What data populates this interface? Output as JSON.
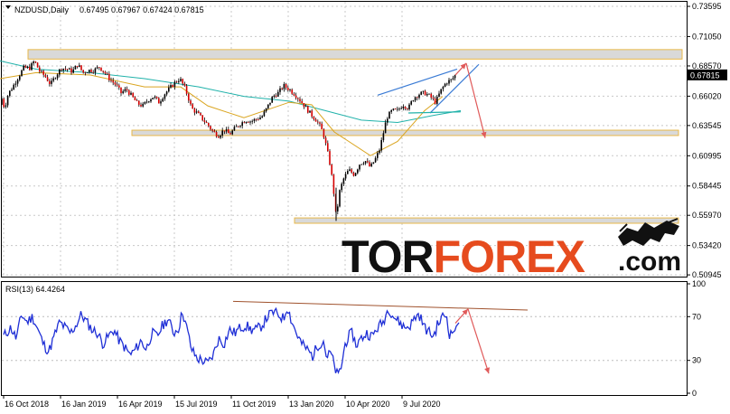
{
  "chart_data": [
    {
      "type": "candlestick",
      "symbol_header": "NZDUSD,Daily",
      "ohlc_header": "0.67495 0.67967 0.67424 0.67815",
      "current_price_label": "0.67815",
      "ylim": [
        0.508,
        0.7398
      ],
      "y_ticks": [
        "0.73595",
        "0.71050",
        "0.68570",
        "0.66020",
        "0.63545",
        "0.60995",
        "0.58445",
        "0.55970",
        "0.53420",
        "0.50945"
      ],
      "x_tick_labels": [
        "16 Oct 2018",
        "16 Jan 2019",
        "16 Apr 2019",
        "15 Jul 2019",
        "11 Oct 2019",
        "13 Jan 2020",
        "10 Apr 2020",
        "9 Jul 2020"
      ],
      "price_path": [
        [
          0,
          0.653
        ],
        [
          2,
          0.658
        ],
        [
          5,
          0.65
        ],
        [
          9,
          0.662
        ],
        [
          14,
          0.668
        ],
        [
          20,
          0.676
        ],
        [
          26,
          0.684
        ],
        [
          33,
          0.684
        ],
        [
          38,
          0.69
        ],
        [
          44,
          0.681
        ],
        [
          50,
          0.677
        ],
        [
          56,
          0.67
        ],
        [
          62,
          0.678
        ],
        [
          68,
          0.684
        ],
        [
          74,
          0.683
        ],
        [
          80,
          0.681
        ],
        [
          86,
          0.687
        ],
        [
          92,
          0.68
        ],
        [
          98,
          0.682
        ],
        [
          104,
          0.682
        ],
        [
          110,
          0.685
        ],
        [
          116,
          0.68
        ],
        [
          122,
          0.674
        ],
        [
          128,
          0.67
        ],
        [
          134,
          0.663
        ],
        [
          140,
          0.666
        ],
        [
          146,
          0.66
        ],
        [
          152,
          0.654
        ],
        [
          158,
          0.652
        ],
        [
          164,
          0.657
        ],
        [
          170,
          0.66
        ],
        [
          176,
          0.655
        ],
        [
          182,
          0.662
        ],
        [
          188,
          0.667
        ],
        [
          194,
          0.672
        ],
        [
          199,
          0.675
        ],
        [
          204,
          0.668
        ],
        [
          208,
          0.66
        ],
        [
          212,
          0.65
        ],
        [
          218,
          0.646
        ],
        [
          224,
          0.641
        ],
        [
          230,
          0.636
        ],
        [
          236,
          0.63
        ],
        [
          242,
          0.627
        ],
        [
          248,
          0.632
        ],
        [
          254,
          0.628
        ],
        [
          260,
          0.633
        ],
        [
          266,
          0.637
        ],
        [
          272,
          0.64
        ],
        [
          278,
          0.639
        ],
        [
          284,
          0.641
        ],
        [
          290,
          0.643
        ],
        [
          296,
          0.651
        ],
        [
          302,
          0.66
        ],
        [
          308,
          0.663
        ],
        [
          314,
          0.669
        ],
        [
          320,
          0.666
        ],
        [
          326,
          0.662
        ],
        [
          332,
          0.657
        ],
        [
          338,
          0.651
        ],
        [
          344,
          0.645
        ],
        [
          350,
          0.64
        ],
        [
          355,
          0.634
        ],
        [
          358,
          0.628
        ],
        [
          362,
          0.615
        ],
        [
          366,
          0.6
        ],
        [
          369,
          0.582
        ],
        [
          372,
          0.558
        ],
        [
          376,
          0.58
        ],
        [
          380,
          0.59
        ],
        [
          386,
          0.598
        ],
        [
          392,
          0.594
        ],
        [
          398,
          0.603
        ],
        [
          404,
          0.606
        ],
        [
          410,
          0.6
        ],
        [
          416,
          0.608
        ],
        [
          420,
          0.615
        ],
        [
          424,
          0.628
        ],
        [
          428,
          0.642
        ],
        [
          434,
          0.648
        ],
        [
          440,
          0.648
        ],
        [
          446,
          0.653
        ],
        [
          452,
          0.65
        ],
        [
          458,
          0.659
        ],
        [
          464,
          0.662
        ],
        [
          470,
          0.663
        ],
        [
          476,
          0.66
        ],
        [
          482,
          0.655
        ],
        [
          488,
          0.665
        ],
        [
          494,
          0.672
        ],
        [
          500,
          0.674
        ],
        [
          504,
          0.678
        ]
      ],
      "moving_averages": [
        {
          "color": "#20b2aa",
          "path": [
            [
              0,
              0.69
            ],
            [
              40,
              0.683
            ],
            [
              100,
              0.68
            ],
            [
              160,
              0.675
            ],
            [
              220,
              0.668
            ],
            [
              270,
              0.66
            ],
            [
              320,
              0.656
            ],
            [
              360,
              0.648
            ],
            [
              400,
              0.64
            ],
            [
              440,
              0.638
            ],
            [
              480,
              0.644
            ],
            [
              510,
              0.648
            ]
          ]
        },
        {
          "color": "#daa520",
          "path": [
            [
              0,
              0.675
            ],
            [
              40,
              0.68
            ],
            [
              100,
              0.678
            ],
            [
              160,
              0.668
            ],
            [
              200,
              0.668
            ],
            [
              230,
              0.652
            ],
            [
              270,
              0.642
            ],
            [
              320,
              0.655
            ],
            [
              345,
              0.653
            ],
            [
              370,
              0.63
            ],
            [
              410,
              0.61
            ],
            [
              440,
              0.622
            ],
            [
              470,
              0.648
            ],
            [
              490,
              0.66
            ]
          ]
        }
      ],
      "zones": [
        {
          "from": 0.6915,
          "to": 0.6995
        },
        {
          "from": 0.627,
          "to": 0.6315
        },
        {
          "from": 0.553,
          "to": 0.5575
        }
      ],
      "channel": {
        "color": "#3a7bd5",
        "upper": [
          [
            418,
            0.661
          ],
          [
            506,
            0.683
          ]
        ],
        "lower": [
          [
            476,
            0.646
          ],
          [
            530,
            0.687
          ]
        ],
        "ma_tail": [
          [
            452,
            0.646
          ],
          [
            510,
            0.647
          ]
        ]
      },
      "forecast": {
        "color": "#e05a5a",
        "up": [
          [
            504,
            0.678
          ],
          [
            516,
            0.688
          ]
        ],
        "down": [
          [
            516,
            0.688
          ],
          [
            537,
            0.625
          ]
        ]
      },
      "arrow_colors": {
        "channel": "#3a7bd5",
        "forecast": "#e05a5a",
        "zone_border": "#e8b84a",
        "zone_fill": "#d9d9d9"
      }
    },
    {
      "type": "line",
      "indicator_header": "RSI(13) 64.4264",
      "ylim": [
        0,
        100
      ],
      "y_ticks": [
        "100",
        "70",
        "30",
        "0"
      ],
      "levels": [
        70,
        30
      ],
      "rsi_path": [
        [
          0,
          52
        ],
        [
          8,
          60
        ],
        [
          14,
          50
        ],
        [
          20,
          72
        ],
        [
          26,
          65
        ],
        [
          32,
          70
        ],
        [
          38,
          58
        ],
        [
          44,
          45
        ],
        [
          50,
          38
        ],
        [
          56,
          52
        ],
        [
          62,
          65
        ],
        [
          68,
          60
        ],
        [
          74,
          55
        ],
        [
          80,
          62
        ],
        [
          86,
          72
        ],
        [
          92,
          65
        ],
        [
          98,
          58
        ],
        [
          104,
          55
        ],
        [
          110,
          45
        ],
        [
          116,
          52
        ],
        [
          122,
          58
        ],
        [
          128,
          48
        ],
        [
          134,
          42
        ],
        [
          140,
          35
        ],
        [
          146,
          40
        ],
        [
          152,
          48
        ],
        [
          158,
          40
        ],
        [
          164,
          55
        ],
        [
          170,
          52
        ],
        [
          176,
          62
        ],
        [
          182,
          68
        ],
        [
          188,
          55
        ],
        [
          194,
          60
        ],
        [
          198,
          75
        ],
        [
          204,
          55
        ],
        [
          208,
          40
        ],
        [
          214,
          32
        ],
        [
          220,
          30
        ],
        [
          226,
          27
        ],
        [
          232,
          35
        ],
        [
          238,
          50
        ],
        [
          244,
          45
        ],
        [
          250,
          58
        ],
        [
          256,
          55
        ],
        [
          262,
          60
        ],
        [
          268,
          62
        ],
        [
          274,
          58
        ],
        [
          280,
          58
        ],
        [
          286,
          62
        ],
        [
          292,
          70
        ],
        [
          298,
          74
        ],
        [
          304,
          72
        ],
        [
          310,
          68
        ],
        [
          314,
          80
        ],
        [
          318,
          68
        ],
        [
          324,
          55
        ],
        [
          330,
          45
        ],
        [
          336,
          40
        ],
        [
          342,
          34
        ],
        [
          348,
          44
        ],
        [
          354,
          48
        ],
        [
          358,
          32
        ],
        [
          362,
          38
        ],
        [
          366,
          25
        ],
        [
          370,
          15
        ],
        [
          374,
          25
        ],
        [
          378,
          45
        ],
        [
          382,
          52
        ],
        [
          386,
          55
        ],
        [
          390,
          44
        ],
        [
          396,
          50
        ],
        [
          402,
          55
        ],
        [
          408,
          52
        ],
        [
          414,
          60
        ],
        [
          420,
          65
        ],
        [
          426,
          78
        ],
        [
          432,
          70
        ],
        [
          438,
          65
        ],
        [
          444,
          60
        ],
        [
          450,
          62
        ],
        [
          456,
          70
        ],
        [
          460,
          72
        ],
        [
          466,
          60
        ],
        [
          472,
          55
        ],
        [
          476,
          52
        ],
        [
          480,
          62
        ],
        [
          486,
          70
        ],
        [
          490,
          72
        ],
        [
          494,
          52
        ],
        [
          498,
          58
        ],
        [
          504,
          64.4
        ]
      ],
      "trendline": {
        "color": "#a0522d",
        "from": [
          258,
          84
        ],
        "to": [
          584,
          76
        ]
      },
      "forecast": {
        "color": "#e05a5a",
        "up": [
          [
            504,
            64
          ],
          [
            518,
            77
          ]
        ],
        "down": [
          [
            518,
            77
          ],
          [
            541,
            18
          ]
        ]
      }
    }
  ],
  "watermark": {
    "text_tor": "TOR",
    "text_forex": "FOREX",
    "text_com": ".com",
    "color_tor": "#111111",
    "color_forex": "#e64b1e",
    "color_com": "#111111"
  }
}
